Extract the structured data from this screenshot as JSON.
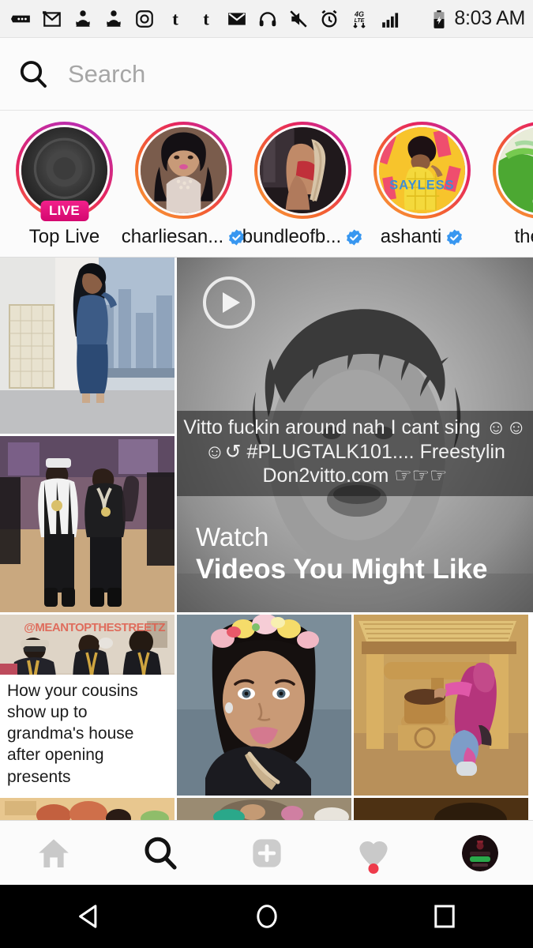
{
  "status_bar": {
    "time": "8:03 AM",
    "icons": [
      "messages-icon",
      "gmail-icon",
      "person-alert-icon",
      "person-alert-icon",
      "instagram-icon",
      "tumblr-icon",
      "tumblr-icon",
      "email-icon",
      "headphones-icon",
      "mute-icon",
      "alarm-icon",
      "4g-lte-icon",
      "signal-bars-icon",
      "battery-charging-icon"
    ],
    "network_label_top": "4G",
    "network_label_bottom": "LTE"
  },
  "search": {
    "placeholder": "Search",
    "value": "",
    "icon": "search-icon"
  },
  "stories": [
    {
      "name": "Top Live",
      "badge": "LIVE",
      "verified": false,
      "type": "live-ring"
    },
    {
      "name": "charliesan...",
      "badge": "",
      "verified": true,
      "type": "avatar"
    },
    {
      "name": "bundleofb...",
      "badge": "",
      "verified": true,
      "type": "avatar"
    },
    {
      "name": "ashanti",
      "badge": "",
      "verified": true,
      "type": "avatar"
    },
    {
      "name": "therea",
      "badge": "",
      "verified": false,
      "type": "avatar"
    }
  ],
  "grid": {
    "video_card": {
      "play_icon": "play-icon",
      "overlay_caption": "Vitto fuckin around nah I cant sing ☺☺ ☺↺ #PLUGTALK101.... Freestylin Don2vitto.com ☞☞☞",
      "label_small": "Watch",
      "label_large": "Videos You Might Like"
    },
    "meme_card": {
      "caption": "How your cousins show up to grandma's house after opening presents",
      "watermark": "@MEANTOPTHESTREETZ"
    }
  },
  "bottom_nav": [
    {
      "name": "home",
      "icon": "home-icon",
      "active": false,
      "badge": false
    },
    {
      "name": "search",
      "icon": "search-icon",
      "active": true,
      "badge": false
    },
    {
      "name": "add-post",
      "icon": "plus-icon",
      "active": false,
      "badge": false
    },
    {
      "name": "activity",
      "icon": "heart-icon",
      "active": false,
      "badge": true
    },
    {
      "name": "profile",
      "icon": "avatar-icon",
      "active": false,
      "badge": false
    }
  ],
  "android_nav": [
    {
      "name": "back",
      "icon": "triangle-back-icon"
    },
    {
      "name": "home",
      "icon": "circle-home-icon"
    },
    {
      "name": "recents",
      "icon": "square-recents-icon"
    }
  ],
  "colors": {
    "live_badge": "#e8157e",
    "badge_dot": "#ee3b4b",
    "verified_blue": "#3897f0",
    "ring_start": "#f9a03b",
    "ring_end": "#b32ec0"
  }
}
